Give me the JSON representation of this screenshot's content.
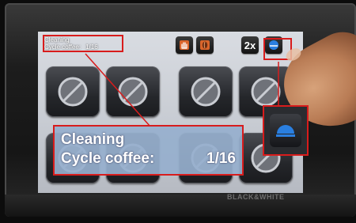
{
  "brand": "BLACK&WHITE",
  "header": {
    "status_line1": "Cleaning",
    "status_line2_label": "Cycle coffee:",
    "status_line2_count": "1/16",
    "buttons": {
      "stop_hand_icon": "hand-stop-icon",
      "bean_icon": "coffee-bean-icon",
      "double_label": "2x",
      "info_icon": "half-dome-icon"
    }
  },
  "popup": {
    "line1": "Cleaning",
    "line2_label": "Cycle coffee:",
    "line2_count": "1/16"
  },
  "tiles": [
    {
      "icon": "disabled-icon"
    },
    {
      "icon": "disabled-icon"
    },
    {
      "icon": "disabled-icon"
    },
    {
      "icon": "disabled-icon"
    },
    {
      "icon": "disabled-icon"
    },
    {
      "icon": "disabled-icon"
    },
    {
      "icon": "disabled-icon"
    },
    {
      "icon": "disabled-icon"
    }
  ],
  "colors": {
    "highlight_red": "#d81c1c",
    "accent_blue": "#2a7fe0",
    "accent_orange": "#d9642a",
    "popup_bg": "#96afcd"
  }
}
